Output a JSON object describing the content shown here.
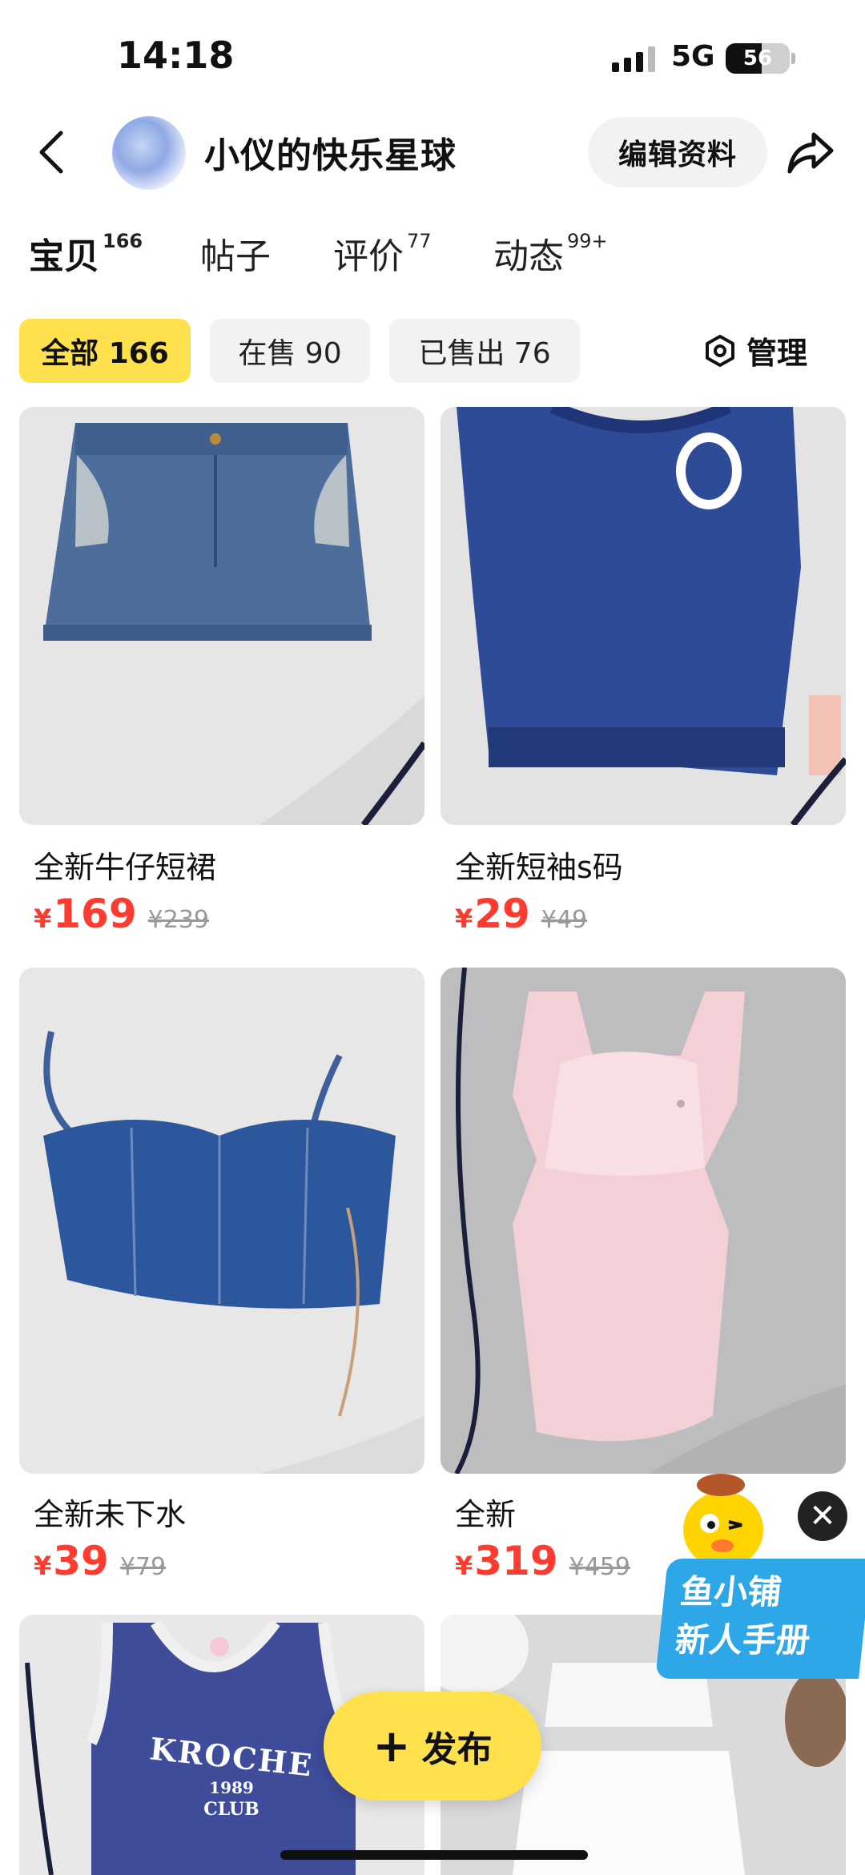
{
  "status_bar": {
    "time": "14:18",
    "network": "5G",
    "battery": "56",
    "battery_level": 0.56
  },
  "header": {
    "shop_name": "小仪的快乐星球",
    "edit_label": "编辑资料"
  },
  "tabs": [
    {
      "label": "宝贝",
      "count": "166",
      "active": true
    },
    {
      "label": "帖子",
      "count": ""
    },
    {
      "label": "评价",
      "count": "77"
    },
    {
      "label": "动态",
      "count": "99+"
    }
  ],
  "filters": [
    {
      "label": "全部 166",
      "active": true
    },
    {
      "label": "在售 90"
    },
    {
      "label": "已售出 76"
    }
  ],
  "manage_label": "管理",
  "products": [
    {
      "title": "全新牛仔短裙",
      "price_symbol": "¥",
      "price": "169",
      "original_price": "¥239"
    },
    {
      "title": "全新短袖s码",
      "price_symbol": "¥",
      "price": "29",
      "original_price": "¥49"
    },
    {
      "title": "全新未下水",
      "price_symbol": "¥",
      "price": "39",
      "original_price": "¥79"
    },
    {
      "title": "全新",
      "price_symbol": "¥",
      "price": "319",
      "original_price": "¥459"
    }
  ],
  "partial_products": [
    {
      "print_text": "KROCHE",
      "print_year": "1989",
      "print_sub": "CLUB"
    }
  ],
  "publish_label": "发布",
  "promo": {
    "line1": "鱼小铺",
    "line2": "新人手册"
  },
  "colors": {
    "accent_yellow": "#ffe14d",
    "price_red": "#ff3b30",
    "promo_blue": "#2ea7e8"
  }
}
